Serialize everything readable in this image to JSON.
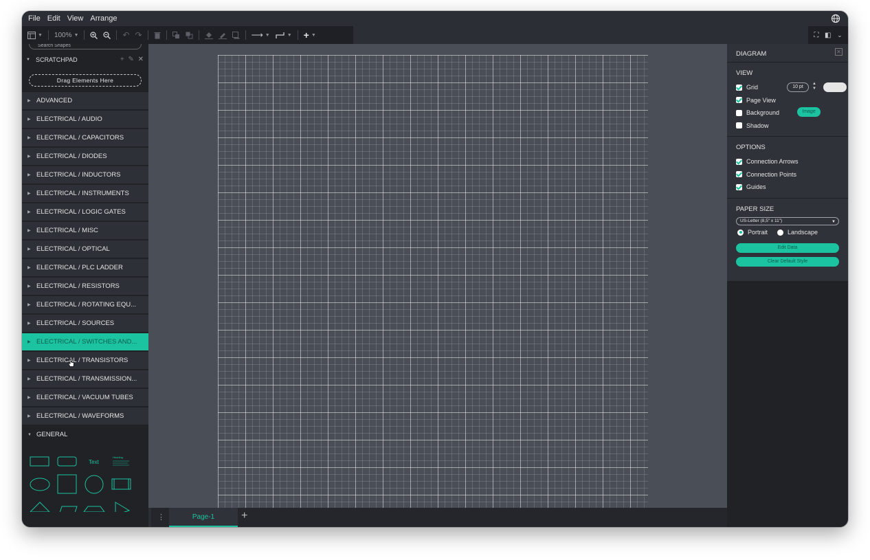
{
  "menubar": {
    "items": [
      "File",
      "Edit",
      "View",
      "Arrange"
    ]
  },
  "toolbar": {
    "zoom": "100%"
  },
  "sidebar": {
    "search_placeholder": "Search Shapes",
    "scratchpad": {
      "title": "SCRATCHPAD",
      "drag_hint": "Drag Elements Here"
    },
    "categories": [
      "ADVANCED",
      "ELECTRICAL / AUDIO",
      "ELECTRICAL / CAPACITORS",
      "ELECTRICAL / DIODES",
      "ELECTRICAL / INDUCTORS",
      "ELECTRICAL / INSTRUMENTS",
      "ELECTRICAL / LOGIC GATES",
      "ELECTRICAL / MISC",
      "ELECTRICAL / OPTICAL",
      "ELECTRICAL / PLC LADDER",
      "ELECTRICAL / RESISTORS",
      "ELECTRICAL / ROTATING EQU...",
      "ELECTRICAL / SOURCES",
      "ELECTRICAL / SWITCHES AND...",
      "ELECTRICAL / TRANSISTORS",
      "ELECTRICAL / TRANSMISSION...",
      "ELECTRICAL / VACUUM TUBES",
      "ELECTRICAL / WAVEFORMS",
      "GENERAL"
    ],
    "shapes": {
      "text_label": "Text",
      "heading_label": "Heading"
    }
  },
  "pagebar": {
    "tab": "Page-1",
    "add": "+"
  },
  "panel": {
    "title": "DIAGRAM",
    "view": {
      "title": "VIEW",
      "grid": "Grid",
      "grid_size": "10 pt",
      "page_view": "Page View",
      "background": "Background",
      "image_button": "Image",
      "shadow": "Shadow"
    },
    "options": {
      "title": "OPTIONS",
      "connection_arrows": "Connection Arrows",
      "connection_points": "Connection Points",
      "guides": "Guides"
    },
    "paper": {
      "title": "PAPER SIZE",
      "size": "US-Letter (8,5\" x 11\")",
      "portrait": "Portrait",
      "landscape": "Landscape",
      "edit_data": "Edit Data",
      "clear_style": "Clear Default Style"
    }
  },
  "colors": {
    "accent": "#1bc3a1",
    "canvas": "#4a4e56",
    "sidebar": "#202226"
  }
}
